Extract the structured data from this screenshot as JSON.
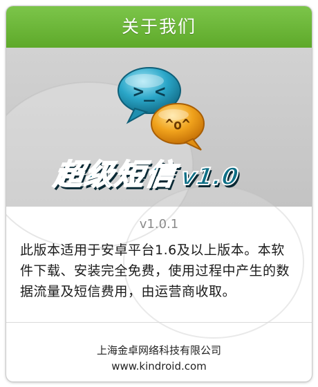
{
  "dialog": {
    "title": "关于我们"
  },
  "banner": {
    "logo_text": "超级短信",
    "logo_version": "v1.0",
    "icon_blue_face": ">_<",
    "icon_orange_face": "^o^"
  },
  "info": {
    "version": "v1.0.1",
    "description": "此版本适用于安卓平台1.6及以上版本。本软件下载、安装完全免费，使用过程中产生的数据流量及短信费用，由运营商收取。"
  },
  "footer": {
    "company": "上海金卓网络科技有限公司",
    "website": "www.kindroid.com"
  },
  "colors": {
    "header_green": "#6ab537",
    "logo_blue": "#0e6f86",
    "bubble_cyan": "#2aa6c8",
    "bubble_orange": "#f0a21c"
  }
}
